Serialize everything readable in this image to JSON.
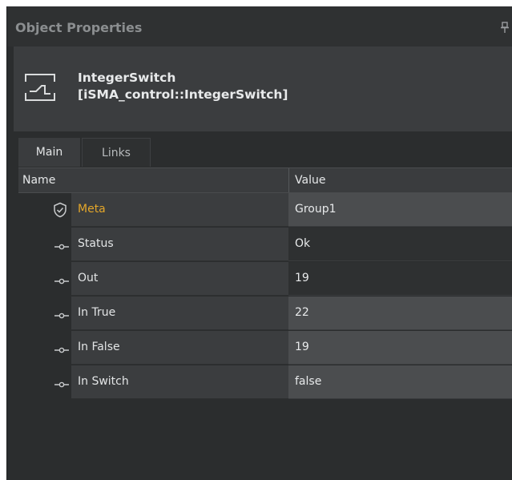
{
  "panel": {
    "title": "Object Properties"
  },
  "object": {
    "name": "IntegerSwitch",
    "type": "[iSMA_control::IntegerSwitch]"
  },
  "tabs": [
    {
      "label": "Main",
      "active": true
    },
    {
      "label": "Links",
      "active": false
    }
  ],
  "grid": {
    "columns": {
      "name": "Name",
      "value": "Value"
    },
    "rows": [
      {
        "icon": "shield-icon",
        "name": "Meta",
        "value": "Group1",
        "value_bg": "#4b4d4f"
      },
      {
        "icon": "slot-icon",
        "name": "Status",
        "value": "Ok",
        "value_bg": "#2e3031"
      },
      {
        "icon": "slot-icon",
        "name": "Out",
        "value": "19",
        "value_bg": "#2e3031"
      },
      {
        "icon": "slot-icon",
        "name": "In True",
        "value": "22",
        "value_bg": "#4b4d4f"
      },
      {
        "icon": "slot-icon",
        "name": "In False",
        "value": "19",
        "value_bg": "#4b4d4f"
      },
      {
        "icon": "slot-icon",
        "name": "In Switch",
        "value": "false",
        "value_bg": "#4b4d4f"
      }
    ]
  },
  "colors": {
    "background": "#2b2d2e",
    "header": "#3b3d3f",
    "meta_accent": "#e3a62a",
    "text": "#e3e5e6"
  }
}
